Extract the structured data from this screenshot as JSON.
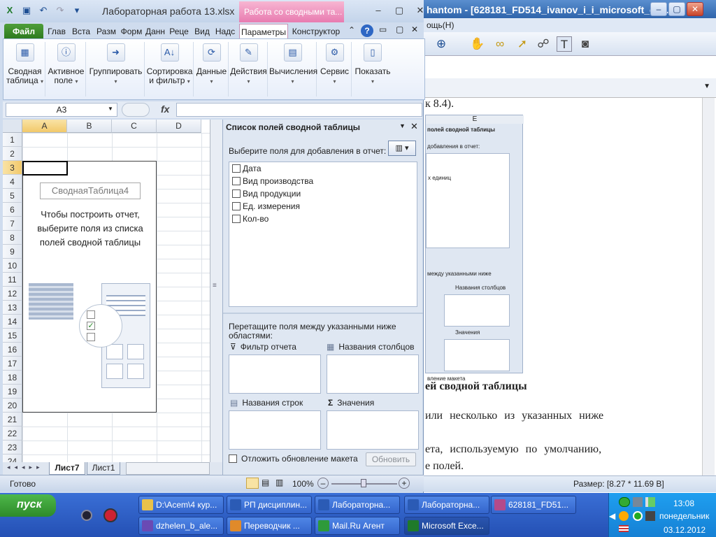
{
  "background_window": {
    "title": "hantom - [628181_FD514_ivanov_i_i_microsoft_exc...",
    "menu_fragment": "ощь(Н)",
    "doc_line_top": "к 8.4).",
    "doc_heading": "ей сводной таблицы",
    "doc_line1": "или несколько из указанных ниже",
    "doc_line2": "ета, используемую по умолчанию,",
    "doc_line3": "е полей.",
    "mini_col": "E",
    "mini_title": "полей сводной таблицы",
    "mini_sub": "добавления в отчет:",
    "mini_item": "х единиц",
    "mini_drag": "между указанными ниже",
    "mini_cols": "Названия столбцов",
    "mini_vals": "Значения",
    "mini_defer": "вление макета",
    "mini_btn": "Обновить",
    "status_size": "Размер: [8.27 * 11.69 В]"
  },
  "excel": {
    "filename": "Лабораторная работа 13.xlsx",
    "context_title": "Работа со сводными та...",
    "tabs": [
      "Файл",
      "Глав",
      "Вста",
      "Разм",
      "Форм",
      "Данн",
      "Реце",
      "Вид",
      "Надс",
      "Параметры",
      "Конструктор"
    ],
    "ribbon_groups": [
      {
        "label1": "Сводная",
        "label2": "таблица",
        "icon": "pivot-icon",
        "glyph": "▦"
      },
      {
        "label1": "Активное",
        "label2": "поле",
        "icon": "active-field-icon",
        "glyph": "ⓘ"
      },
      {
        "label1": "Группировать",
        "label2": "",
        "icon": "group-icon",
        "glyph": "➜"
      },
      {
        "label1": "Сортировка",
        "label2": "и фильтр",
        "icon": "sort-icon",
        "glyph": "A↓"
      },
      {
        "label1": "Данные",
        "label2": "",
        "icon": "data-icon",
        "glyph": "⟳"
      },
      {
        "label1": "Действия",
        "label2": "",
        "icon": "actions-icon",
        "glyph": "✎"
      },
      {
        "label1": "Вычисления",
        "label2": "",
        "icon": "calc-icon",
        "glyph": "▤"
      },
      {
        "label1": "Сервис",
        "label2": "",
        "icon": "tools-icon",
        "glyph": "⚙"
      },
      {
        "label1": "Показать",
        "label2": "",
        "icon": "show-icon",
        "glyph": "▯"
      }
    ],
    "name_box": "A3",
    "fx": "fx",
    "columns": [
      "A",
      "B",
      "C",
      "D"
    ],
    "rows": [
      "1",
      "2",
      "3",
      "4",
      "5",
      "6",
      "7",
      "8",
      "9",
      "10",
      "11",
      "12",
      "13",
      "14",
      "15",
      "16",
      "17",
      "18",
      "19",
      "20",
      "21",
      "22",
      "23",
      "24"
    ],
    "pivot_name": "СводнаяТаблица4",
    "pivot_instruction": "Чтобы построить отчет, выберите поля из списка полей сводной таблицы",
    "sheet_tabs": [
      "Лист7",
      "Лист1"
    ],
    "status_ready": "Готово",
    "zoom": "100%"
  },
  "pane": {
    "title": "Список полей сводной таблицы",
    "subtitle": "Выберите поля для добавления в отчет:",
    "fields": [
      "Дата",
      "Вид производства",
      "Вид продукции",
      "Ед. измерения",
      "Кол-во"
    ],
    "drag_text": "Перетащите поля между указанными ниже областями:",
    "area_filter": "Фильтр отчета",
    "area_columns": "Названия столбцов",
    "area_rows": "Названия строк",
    "area_values": "Значения",
    "sigma": "Σ",
    "defer": "Отложить обновление макета",
    "update": "Обновить"
  },
  "taskbar": {
    "start": "пуск",
    "row1": [
      {
        "label": "D:\\Acem\\4 кур...",
        "icon": "folder-icon",
        "color": "#e8c14a"
      },
      {
        "label": "РП дисциплин...",
        "icon": "word-icon",
        "color": "#2b5bb5"
      },
      {
        "label": "Лабораторна...",
        "icon": "word-icon",
        "color": "#2b5bb5"
      },
      {
        "label": "Лабораторна...",
        "icon": "word-icon",
        "color": "#2b5bb5"
      },
      {
        "label": "628181_FD51...",
        "icon": "pdf-icon",
        "color": "#b44a8a"
      }
    ],
    "row2": [
      {
        "label": "dzhelen_b_ale...",
        "icon": "pdf-icon",
        "color": "#6a4ab4"
      },
      {
        "label": "Переводчик ...",
        "icon": "translate-icon",
        "color": "#e08a2a"
      },
      {
        "label": "Mail.Ru Агент",
        "icon": "mail-icon",
        "color": "#2e9a3a"
      },
      {
        "label": "Microsoft Exce...",
        "icon": "excel-icon",
        "color": "#1f7a2a"
      }
    ],
    "time": "13:08",
    "day": "понедельник",
    "date": "03.12.2012"
  }
}
